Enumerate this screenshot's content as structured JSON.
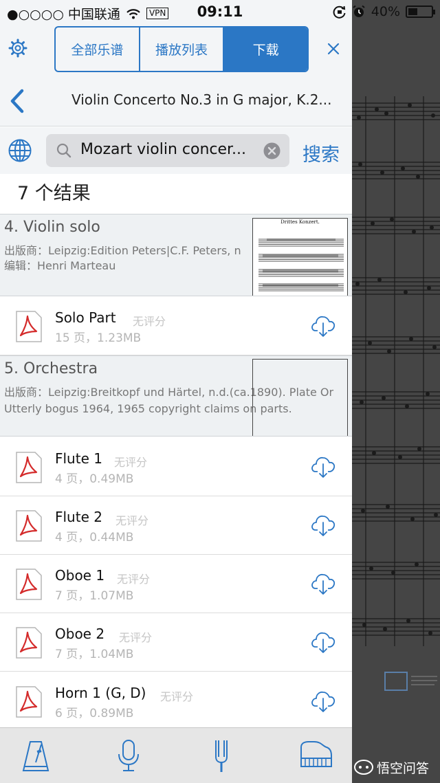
{
  "status_bar": {
    "carrier": "●○○○○ 中国联通",
    "vpn": "VPN",
    "time": "09:11",
    "battery": "40%",
    "battery_level": 0.4
  },
  "segments": [
    {
      "label": "全部乐谱",
      "active": false
    },
    {
      "label": "播放列表",
      "active": false
    },
    {
      "label": "下载",
      "active": true
    }
  ],
  "page_title": "Violin Concerto No.3 in G major, K.2...",
  "search": {
    "query": "Mozart violin concer...",
    "button": "搜索"
  },
  "results_count": "7 个结果",
  "works": [
    {
      "title": "4. Violin solo",
      "publisher": "出版商：Leipzig:Edition Peters|C.F. Peters, n",
      "editor": "编辑：Henri Marteau",
      "thumb_title": "Drittes Konzert.",
      "parts": [
        {
          "name": "Solo Part",
          "rating": "无评分",
          "meta": "15 页，1.23MB"
        }
      ]
    },
    {
      "title": "5. Orchestra",
      "publisher": "出版商：Leipzig:Breitkopf und Härtel, n.d.(ca.1890). Plate Or",
      "note": "Utterly bogus 1964, 1965 copyright claims on parts.",
      "parts": [
        {
          "name": "Flute 1",
          "rating": "无评分",
          "meta": "4 页，0.49MB"
        },
        {
          "name": "Flute 2",
          "rating": "无评分",
          "meta": "4 页，0.44MB"
        },
        {
          "name": "Oboe 1",
          "rating": "无评分",
          "meta": "7 页，1.07MB"
        },
        {
          "name": "Oboe 2",
          "rating": "无评分",
          "meta": "7 页，1.04MB"
        },
        {
          "name": "Horn 1 (G, D)",
          "rating": "无评分",
          "meta": "6 页，0.89MB"
        }
      ]
    }
  ],
  "toolbar": [
    "metronome-icon",
    "microphone-icon",
    "tuning-fork-icon",
    "piano-icon"
  ],
  "watermark": "悟空问答",
  "colors": {
    "accent": "#2b77c5",
    "pdf_red": "#d42b2b"
  }
}
